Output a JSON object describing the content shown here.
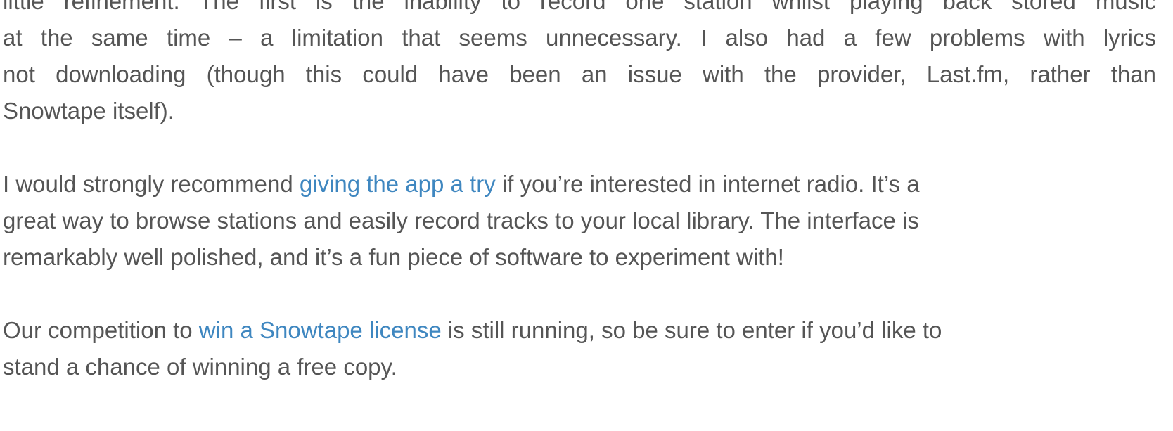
{
  "article": {
    "paragraph_1": {
      "lines": [
        "little refinement. The first is the inability to record one station whilst playing back stored music",
        "at the same time – a limitation that seems unnecessary. I also had a few problems with lyrics",
        "not downloading (though this could have been an issue with the provider, Last.fm, rather than",
        "Snowtape itself)."
      ]
    },
    "paragraph_2": {
      "before_link": "I would strongly recommend ",
      "link_text": "giving the app a try",
      "after_link_line1": " if you’re interested in internet radio. It’s a",
      "line2": "great way to browse stations and easily record tracks to your local library. The interface is",
      "line3": "remarkably well polished, and it’s a fun piece of software to experiment with!"
    },
    "paragraph_3": {
      "before_link": "Our competition to ",
      "link_text": "win a Snowtape license",
      "after_link_line1": " is still running, so be sure to enter if you’d like to",
      "line2": "stand a chance of winning a free copy."
    }
  },
  "colors": {
    "body_text": "#555555",
    "link": "#3f87c0",
    "background": "#ffffff"
  }
}
